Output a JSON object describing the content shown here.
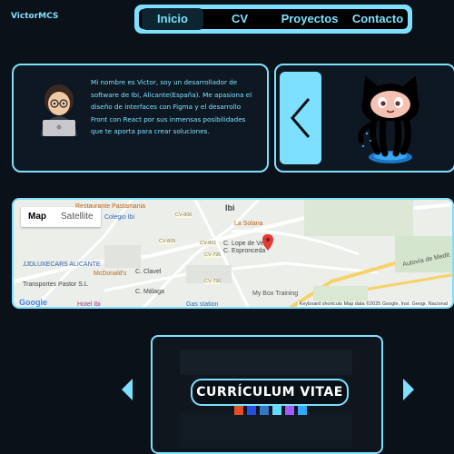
{
  "brand": "VictorMCS",
  "nav": {
    "items": [
      {
        "label": "Inicio",
        "active": true
      },
      {
        "label": "CV",
        "active": false
      },
      {
        "label": "Proyectos",
        "active": false
      },
      {
        "label": "Contacto",
        "active": false
      }
    ]
  },
  "about": {
    "text": "Mi nombre es Victor, soy un desarrollador de software de Ibi, Alicante(España). Me apasiona el diseño de interfaces con Figma y el desarrollo Front con React por sus inmensas posibilidades que te aporta para crear soluciones."
  },
  "map": {
    "toggle_map": "Map",
    "toggle_satellite": "Satellite",
    "labels": {
      "restaurante": "Restaurante Pastamania",
      "ibi": "Ibi",
      "colegio": "Colegio Ibi",
      "solana": "La Solana",
      "cv806": "CV-806",
      "cv805": "CV-805",
      "cv801": "CV-801",
      "cv795": "CV-795",
      "cv796": "CV-796",
      "lope": "C. Lope de Vega",
      "espronceda": "C. Espronceda",
      "jjdluxecars": "JJDLUXECARS ALICANTE",
      "transportes": "Transportes Pastor S.L",
      "mcdonalds": "McDonald's",
      "mybox": "My Box Training",
      "autovia": "Autovía de Medit",
      "hotel": "Hotel Ibi",
      "clavel": "C. Clavel",
      "malaga": "C. Málaga",
      "gas": "Gas station"
    },
    "attribution": "Keyboard shortcuts   Map data ©2025 Google, Inst. Geogr. Nacional",
    "google": "Google"
  },
  "cv": {
    "title": "CURRÍCULUM VITAE"
  },
  "colors": {
    "accent": "#7ee0ff",
    "background": "#0b1118",
    "pin": "#e53935"
  }
}
